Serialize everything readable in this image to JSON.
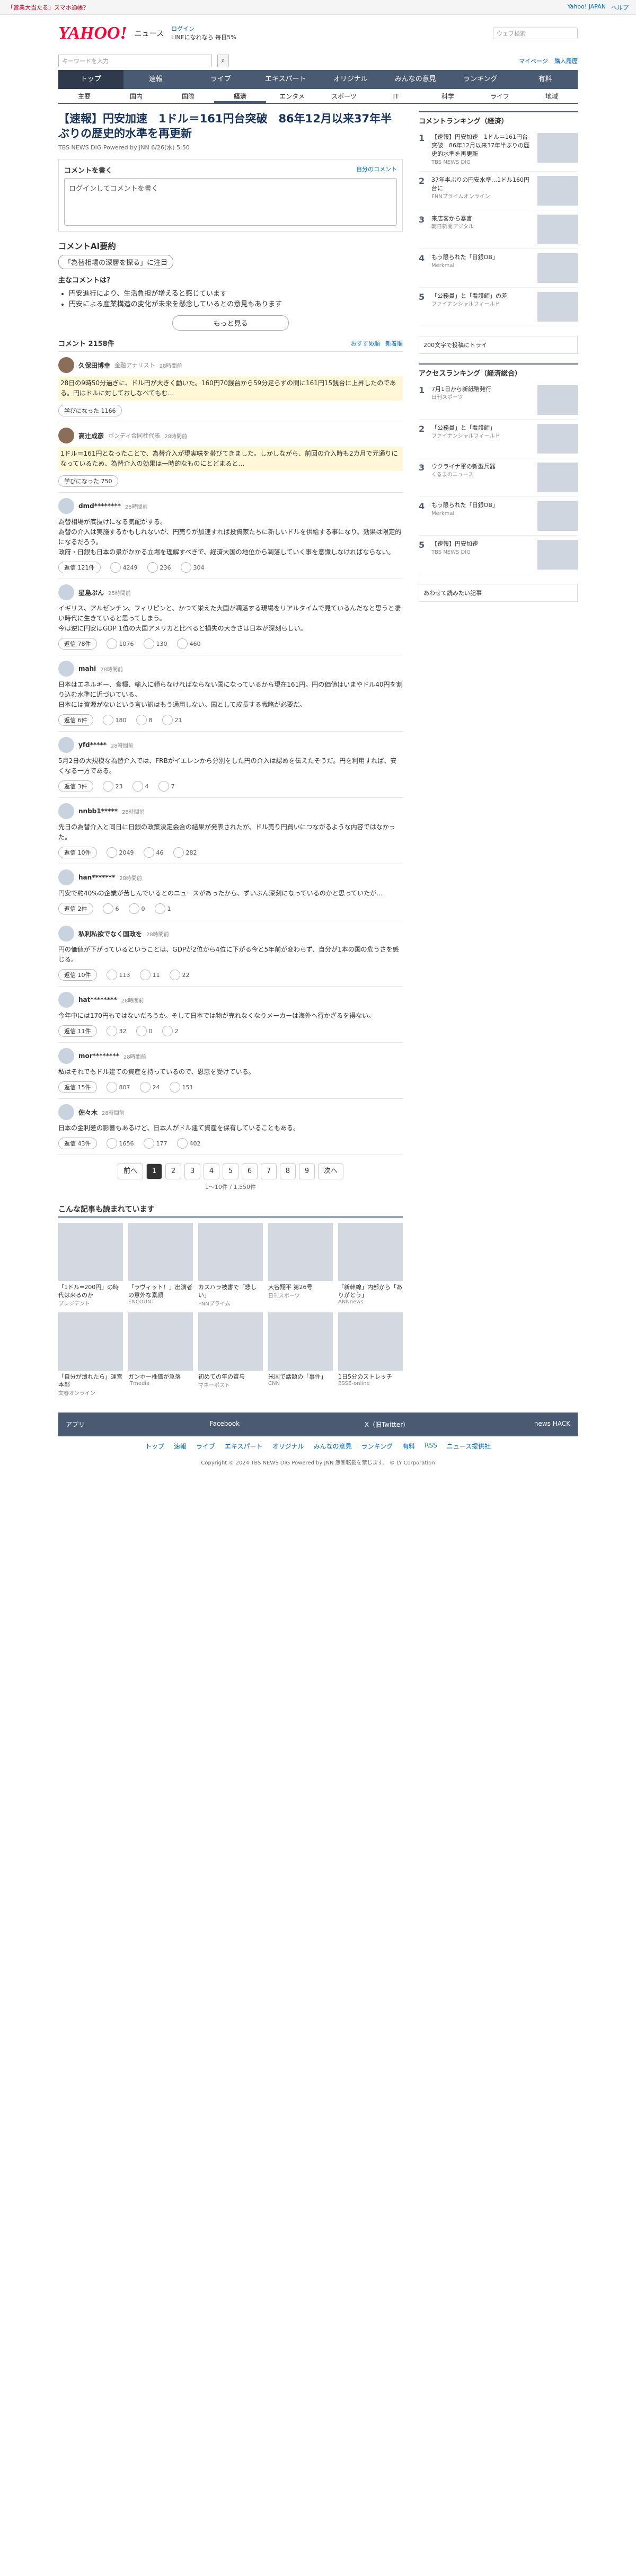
{
  "topbar": {
    "news": "「営業大当たる」スマホ通帳？",
    "right": [
      "Yahoo! JAPAN",
      "ヘルプ"
    ]
  },
  "header": {
    "logo": "YAHOO!",
    "logo_sub": "ニュース",
    "promo": "ログイン",
    "promo2": "LINEになれなら 毎日5%",
    "search_placeholder": "ウェブ検索"
  },
  "subsearch": {
    "placeholder": "キーワードを入力",
    "right": [
      "マイページ",
      "購入履歴"
    ]
  },
  "nav1": [
    "トップ",
    "速報",
    "ライブ",
    "エキスパート",
    "オリジナル",
    "みんなの意見",
    "ランキング",
    "有料"
  ],
  "nav2": [
    "主要",
    "国内",
    "国際",
    "経済",
    "エンタメ",
    "スポーツ",
    "IT",
    "科学",
    "ライフ",
    "地域"
  ],
  "article": {
    "title": "【速報】円安加速　1ドル＝161円台突破　86年12月以来37年半ぶりの歴史的水準を再更新",
    "source": "TBS NEWS DIG Powered by JNN",
    "time": "6/26(水) 5:50"
  },
  "comment_box": {
    "title": "コメントを書く",
    "placeholder": "ログインしてコメントを書く",
    "note": "自分のコメント"
  },
  "ai": {
    "title": "コメントAI要約",
    "tag": "「為替相場の深層を探る」に注目",
    "head": "主なコメントは？",
    "points": [
      "円安進行により、生活負担が増えると感じています",
      "円安による産業構造の変化が未来を懸念しているとの意見もあります"
    ],
    "more": "もっと見る"
  },
  "comments_head": {
    "label": "コメント 2158件",
    "sort": [
      "おすすめ順",
      "新着順"
    ]
  },
  "comments": [
    {
      "user": "久保田博幸",
      "role": "金融アナリスト",
      "time": "28時間前",
      "text": "28日の9時50分過ぎに、ドル円が大きく動いた。160円70銭台から59分足らずの間に161円15銭台に上昇したのである。円はドルに対しておしなべてもむ…",
      "vote": "学びになった 1166",
      "expert": true
    },
    {
      "user": "高辻成彦",
      "role": "ポンディ合同社代表",
      "time": "28時間前",
      "text": "1ドル＝161円となったことで、為替介入が現実味を帯びてきました。しかしながら、前回の介入時も2カ月で元通りになっているため、為替介入の効果は一時的なものにとどまると…",
      "vote": "学びになった 750",
      "expert": true
    },
    {
      "user": "dmd********",
      "time": "28時間前",
      "text": "為替相場が底抜けになる気配がする。\n為替の介入は実施するかもしれないが、円売りが加速すれば投資家たちに新しいドルを供給する事になり、効果は限定的になるだろう。\n政府・日銀も日本の景がかかる立場を理解すべきで、経済大国の地位から凋落していく事を意識しなければならない。",
      "reply": "返信 121件",
      "a": "4249",
      "b": "236",
      "c": "304"
    },
    {
      "user": "星島ぷん",
      "time": "25時間前",
      "text": "イギリス、アルゼンチン、フィリピンと、かつて栄えた大国が凋落する現場をリアルタイムで見ているんだなと思うと凄い時代に生きていると思ってしまう。\n今は逆に円安はGDP 1位の大国アメリカと比べると損失の大きさは日本が深刻らしい。",
      "reply": "返信 78件",
      "a": "1076",
      "b": "130",
      "c": "460"
    },
    {
      "user": "mahi",
      "time": "28時間前",
      "text": "日本はエネルギー、食糧、輸入に頼らなければならない国になっているから現在161円。円の価値はいまやドル40円を割り込む水準に近づいている。\n日本には資源がないという言い訳はもう通用しない。国として成長する戦略が必要だ。",
      "reply": "返信 6件",
      "a": "180",
      "b": "8",
      "c": "21"
    },
    {
      "user": "yfd*****",
      "time": "28時間前",
      "text": "5月2日の大規模な為替介入では、FRBがイエレンから分別をした円の介入は認めを伝えたそうだ。円を利用すれば、安くなる一方である。",
      "reply": "返信 3件",
      "a": "23",
      "b": "4",
      "c": "7"
    },
    {
      "user": "nnbb1*****",
      "time": "28時間前",
      "text": "先日の為替介入と同日に日銀の政策決定会合の結果が発表されたが、ドル売り円買いにつながるような内容ではなかった。",
      "reply": "返信 10件",
      "a": "2049",
      "b": "46",
      "c": "282"
    },
    {
      "user": "han*******",
      "time": "28時間前",
      "text": "円安で約40%の企業が苦しんでいるとのニュースがあったから、ずいぶん深刻になっているのかと思っていたが…",
      "reply": "返信 2件",
      "a": "6",
      "b": "0",
      "c": "1"
    },
    {
      "user": "私利私欲でなく国政を",
      "time": "28時間前",
      "text": "円の価値が下がっているということは、GDPが2位から4位に下がる今と5年前が変わらず、自分が1本の国の危うさを感じる。",
      "reply": "返信 10件",
      "a": "113",
      "b": "11",
      "c": "22"
    },
    {
      "user": "hat********",
      "time": "28時間前",
      "text": "今年中には170円もではないだろうか。そして日本では物が売れなくなりメーカーは海外へ行かざるを得ない。",
      "reply": "返信 11件",
      "a": "32",
      "b": "0",
      "c": "2"
    },
    {
      "user": "mor********",
      "time": "28時間前",
      "text": "私はそれでもドル建ての資産を持っているので、恩恵を受けている。",
      "reply": "返信 15件",
      "a": "807",
      "b": "24",
      "c": "151"
    },
    {
      "user": "佐々木",
      "time": "28時間前",
      "text": "日本の金利差の影響もあるけど、日本人がドル建て資産を保有していることもある。",
      "reply": "返信 43件",
      "a": "1656",
      "b": "177",
      "c": "402"
    }
  ],
  "pager": {
    "prev": "前へ",
    "pages": [
      "1",
      "2",
      "3",
      "4",
      "5",
      "6",
      "7",
      "8",
      "9"
    ],
    "next": "次へ",
    "count": "1〜10件 / 1,550件"
  },
  "related": {
    "title": "こんな記事も読まれています",
    "items": [
      {
        "t": "「1ドル=200円」の時代は来るのか",
        "s": "プレジデント"
      },
      {
        "t": "「ラヴィット！」出演者の意外な素顔",
        "s": "ENCOUNT"
      },
      {
        "t": "カスハラ被害で「悲しい」",
        "s": "FNNプライム"
      },
      {
        "t": "大谷翔平 第26号",
        "s": "日刊スポーツ"
      },
      {
        "t": "「新幹線」内部から「ありがとう」",
        "s": "ANNnews"
      },
      {
        "t": "「自分が潰れたら」運営本部",
        "s": "文春オンライン"
      },
      {
        "t": "ガンホー株価が急落",
        "s": "ITmedia"
      },
      {
        "t": "初めての年の賞与",
        "s": "マネーポスト"
      },
      {
        "t": "米国で話題の「事件」",
        "s": "CNN"
      },
      {
        "t": "1日5分のストレッチ",
        "s": "ESSE-online"
      }
    ]
  },
  "side": {
    "ranking_title": "コメントランキング（経済）",
    "ranking": [
      {
        "n": "1",
        "t": "【速報】円安加速　1ドル＝161円台突破　86年12月以来37年半ぶりの歴史的水準を再更新",
        "s": "TBS NEWS DIG"
      },
      {
        "n": "2",
        "t": "37年半ぶりの円安水準…1ドル160円台に",
        "s": "FNNプライムオンライン"
      },
      {
        "n": "3",
        "t": "来店客から暴言",
        "s": "朝日新聞デジタル"
      },
      {
        "n": "4",
        "t": "もう限られた「日銀OB」",
        "s": "Merkmal"
      },
      {
        "n": "5",
        "t": "「公務員」と「看護師」の差",
        "s": "ファイナンシャルフィールド"
      }
    ],
    "ad1": "200文字で投稿にトライ",
    "access_title": "アクセスランキング（経済総合）",
    "access": [
      {
        "n": "1",
        "t": "7月1日から新紙幣発行",
        "s": "日刊スポーツ"
      },
      {
        "n": "2",
        "t": "「公務員」と「看護師」",
        "s": "ファイナンシャルフィールド"
      },
      {
        "n": "3",
        "t": "ウクライナ軍の新型兵器",
        "s": "くるまのニュース"
      },
      {
        "n": "4",
        "t": "もう限られた「日銀OB」",
        "s": "Merkmal"
      },
      {
        "n": "5",
        "t": "【速報】円安加速",
        "s": "TBS NEWS DIG"
      }
    ],
    "ad2": "あわせて読みたい記事"
  },
  "footer": {
    "apps": [
      "アプリ",
      "Facebook",
      "X（旧Twitter）",
      "news HACK"
    ],
    "nav": [
      "トップ",
      "速報",
      "ライブ",
      "エキスパート",
      "オリジナル",
      "みんなの意見",
      "ランキング",
      "有料",
      "RSS",
      "ニュース提供社"
    ],
    "copy": "Copyright © 2024 TBS NEWS DIG Powered by JNN 無断転載を禁じます。 © LY Corporation"
  }
}
